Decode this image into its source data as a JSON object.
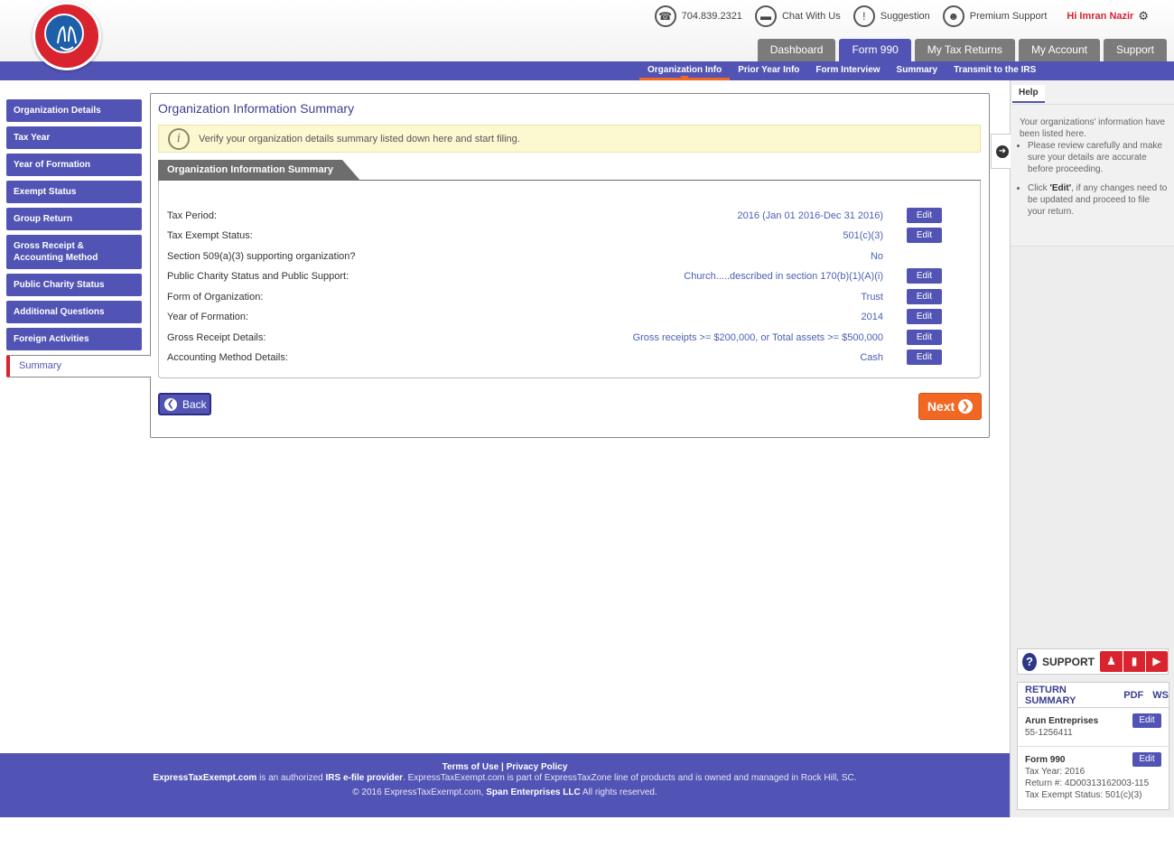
{
  "header": {
    "phone": "704.839.2321",
    "chat": "Chat With Us",
    "suggestion": "Suggestion",
    "premium": "Premium Support",
    "greeting": "Hi Imran Nazir"
  },
  "main_tabs": [
    "Dashboard",
    "Form 990",
    "My Tax Returns",
    "My Account",
    "Support"
  ],
  "sub_tabs": [
    "Organization Info",
    "Prior Year Info",
    "Form Interview",
    "Summary",
    "Transmit to the IRS"
  ],
  "sidebar": {
    "items": [
      "Organization Details",
      "Tax Year",
      "Year of Formation",
      "Exempt Status",
      "Group Return",
      "Gross Receipt & Accounting Method",
      "Public Charity Status",
      "Additional Questions",
      "Foreign Activities",
      "Summary"
    ]
  },
  "main": {
    "title": "Organization Information Summary",
    "info": "Verify your organization details summary listed down here and start filing.",
    "section_title": "Organization Information Summary",
    "edit_label": "Edit",
    "rows": [
      {
        "label": "Tax Period:",
        "value": "2016 (Jan 01 2016-Dec 31 2016)"
      },
      {
        "label": "Tax Exempt Status:",
        "value": "501(c)(3)"
      },
      {
        "label": "Section 509(a)(3) supporting organization?",
        "value": "No"
      },
      {
        "label": "Public Charity Status and Public Support:",
        "value": "Church.....described in section 170(b)(1)(A)(i)"
      },
      {
        "label": "Form of Organization:",
        "value": "Trust"
      },
      {
        "label": "Year of Formation:",
        "value": "2014"
      },
      {
        "label": "Gross Receipt Details:",
        "value": "Gross receipts >= $200,000, or Total assets >= $500,000"
      },
      {
        "label": "Accounting Method Details:",
        "value": "Cash"
      }
    ],
    "back_label": "Back",
    "next_label": "Next"
  },
  "help": {
    "tab": "Help",
    "intro": "Your organizations' information have been listed here.",
    "bullet1": "Please review carefully and make sure your details are accurate before proceeding.",
    "bullet2_pre": "Click ",
    "bullet2_bold": "'Edit'",
    "bullet2_post": ", if any changes need to be updated and proceed to file your return."
  },
  "support": {
    "label": "SUPPORT"
  },
  "return_summary": {
    "title": "RETURN SUMMARY",
    "pdf": "PDF",
    "ws": "WS",
    "org_name": "Arun Entreprises",
    "ein": "55-1256411",
    "form": "Form 990",
    "tax_year": "Tax Year: 2016",
    "return_no": "Return #: 4D00313162003-115",
    "exempt_status": "Tax Exempt Status: 501(c)(3)",
    "edit": "Edit"
  },
  "footer": {
    "terms": "Terms of Use",
    "sep": "|",
    "privacy": "Privacy Policy",
    "site": "ExpressTaxExempt.com",
    "line_a": " is an authorized ",
    "irs": "IRS e-file provider",
    "line_b": ". ExpressTaxExempt.com is part of ExpressTaxZone line of products and is owned and managed in Rock Hill, SC.",
    "copy_a": "© 2016 ExpressTaxExempt.com, ",
    "company": "Span Enterprises LLC",
    "copy_b": " All rights reserved."
  },
  "colors": {
    "primary": "#5154b4",
    "accent": "#f26722",
    "brand_red": "#d9232e"
  }
}
